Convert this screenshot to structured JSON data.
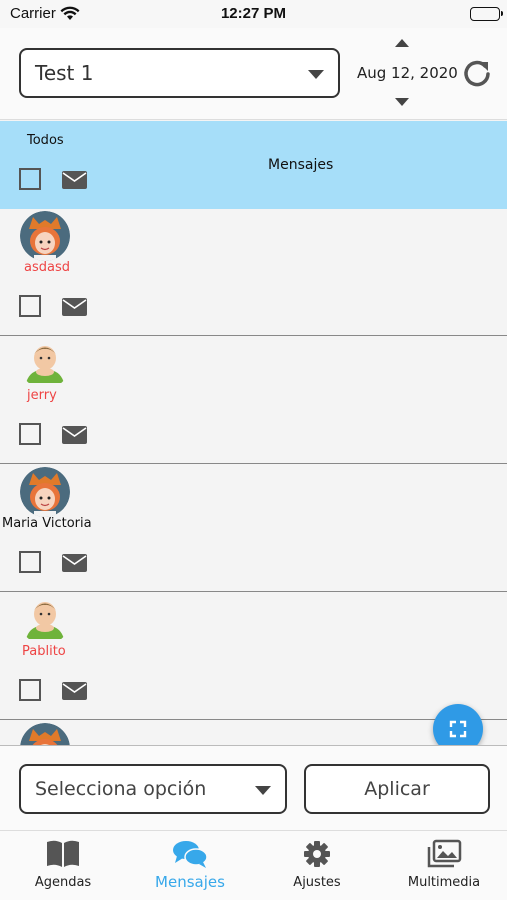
{
  "status_bar": {
    "carrier": "Carrier",
    "time": "12:27 PM"
  },
  "header": {
    "group_select_value": "Test 1",
    "date": "Aug 12, 2020"
  },
  "list_header": {
    "select_all_label": "Todos",
    "messages_label": "Mensajes"
  },
  "students": [
    {
      "name": "asdasd",
      "avatar": "girl-avatar",
      "name_color": "#e44444"
    },
    {
      "name": "jerry",
      "avatar": "boy-avatar",
      "name_color": "#e44444"
    },
    {
      "name": "Maria Victoria",
      "avatar": "girl-avatar",
      "name_color": "#111111"
    },
    {
      "name": "Pablito",
      "avatar": "boy-avatar",
      "name_color": "#e44444"
    }
  ],
  "bottom": {
    "option_select_placeholder": "Selecciona opción",
    "apply_label": "Aplicar"
  },
  "tabs": [
    {
      "label": "Agendas",
      "icon": "book-icon",
      "active": false
    },
    {
      "label": "Mensajes",
      "icon": "chat-icon",
      "active": true
    },
    {
      "label": "Ajustes",
      "icon": "gear-icon",
      "active": false
    },
    {
      "label": "Multimedia",
      "icon": "images-icon",
      "active": false
    }
  ],
  "colors": {
    "accent": "#37a8ea",
    "header_row": "#a6def9",
    "fab": "#2f9ae6",
    "name_red": "#e44444"
  }
}
